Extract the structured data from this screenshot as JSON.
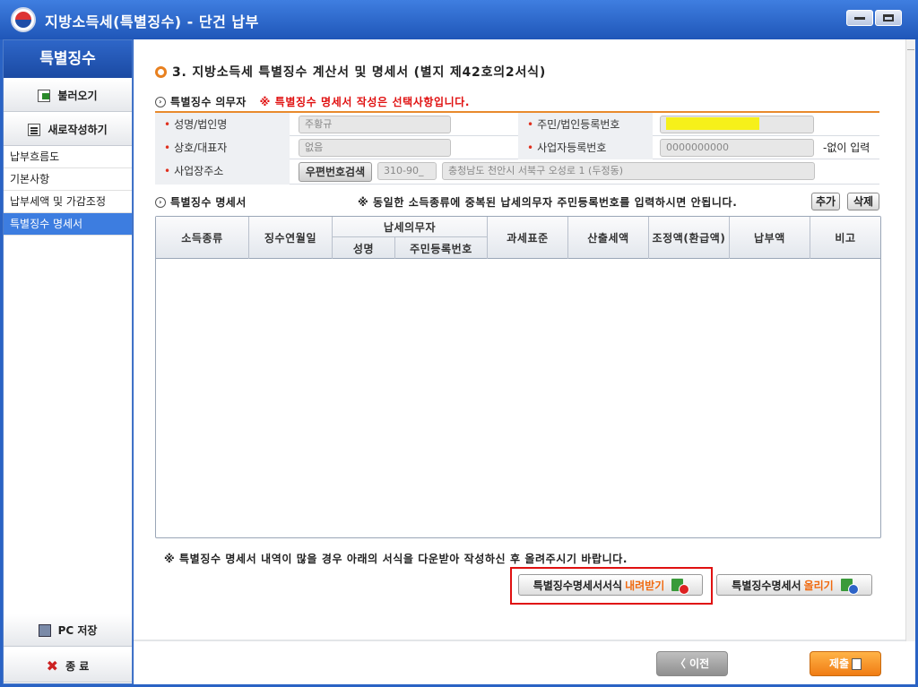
{
  "window": {
    "title": "지방소득세(특별징수) - 단건 납부"
  },
  "sidebar": {
    "header": "특별징수",
    "load_label": "불러오기",
    "new_label": "새로작성하기",
    "items": [
      {
        "label": "납부흐름도"
      },
      {
        "label": "기본사항"
      },
      {
        "label": "납부세액 및 가감조정"
      },
      {
        "label": "특별징수 명세서"
      }
    ],
    "active_index": 3,
    "save_label": "PC 저장",
    "exit_label": "종 료"
  },
  "main": {
    "section_title": "3. 지방소득세 특별징수 계산서 및 명세서 (별지 제42호의2서식)",
    "withholder": {
      "title": "특별징수 의무자",
      "note": "※ 특별징수 명세서 작성은 선택사항입니다.",
      "fields": {
        "name_label": "성명/법인명",
        "name_value": "주황규",
        "resident_no_label": "주민/법인등록번호",
        "trade_name_label": "상호/대표자",
        "trade_name_value": "없음",
        "biz_no_label": "사업자등록번호",
        "biz_no_value": "0000000000",
        "biz_no_hint": "-없이 입력",
        "address_label": "사업장주소",
        "zip_search_label": "우편번호검색",
        "zip_value": "310-90_",
        "address_value": "충청남도 천안시 서북구 오성로 1 (두정동)"
      }
    },
    "details": {
      "title": "특별징수 명세서",
      "note": "※ 동일한 소득종류에 중복된 납세의무자 주민등록번호를 입력하시면 안됩니다.",
      "add_label": "추가",
      "delete_label": "삭제",
      "columns": {
        "income_type": "소득종류",
        "collect_month": "징수연월일",
        "taxpayer": "납세의무자",
        "taxpayer_name": "성명",
        "taxpayer_rrn": "주민등록번호",
        "tax_base": "과세표준",
        "calc_tax": "산출세액",
        "adjust": "조정액(환급액)",
        "payment": "납부액",
        "remark": "비고"
      }
    },
    "bottom_note": "※ 특별징수 명세서 내역이 많을 경우 아래의 서식을 다운받아 작성하신 후 올려주시기 바랍니다.",
    "download_label_main": "특별징수명세서서식",
    "download_label_accent": "내려받기",
    "upload_label_main": "특별징수명세서",
    "upload_label_accent": "올리기",
    "prev_label": "〈 이전",
    "submit_label": "제출"
  },
  "colors": {
    "accent_orange": "#f06a10",
    "note_red": "#e01010",
    "highlight": "#f6f01a",
    "titlebar_blue": "#1f56b8"
  }
}
